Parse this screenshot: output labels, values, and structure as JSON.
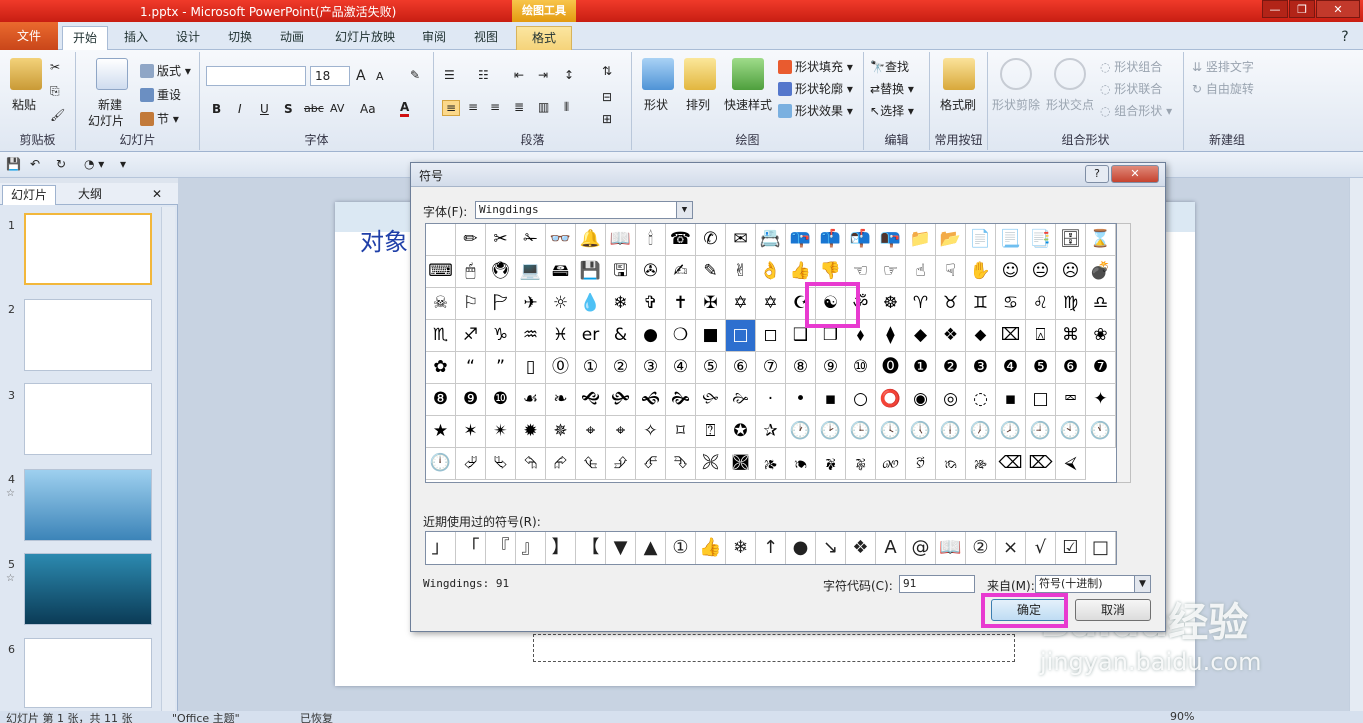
{
  "window": {
    "title": "1.pptx - Microsoft PowerPoint(产品激活失败)",
    "context_tab": "绘图工具",
    "buttons": [
      "—",
      "❐",
      "✕"
    ]
  },
  "tabs": {
    "file": "文件",
    "items": [
      "开始",
      "插入",
      "设计",
      "切换",
      "动画",
      "幻灯片放映",
      "审阅",
      "视图",
      "格式"
    ],
    "active": "开始"
  },
  "ribbon": {
    "clipboard": {
      "label": "剪贴板",
      "paste": "粘贴"
    },
    "slides": {
      "label": "幻灯片",
      "new_slide": "新建\n幻灯片",
      "new_slide_a": "新建",
      "new_slide_b": "幻灯片",
      "layout": "版式",
      "reset": "重设",
      "section": "节"
    },
    "font": {
      "label": "字体",
      "size": "18",
      "font_name": "",
      "bold": "B",
      "italic": "I",
      "underline": "U",
      "shadow": "S",
      "strike": "abc",
      "spacing": "AV",
      "case": "Aa",
      "color": "A",
      "grow": "A",
      "shrink": "A"
    },
    "paragraph": {
      "label": "段落"
    },
    "drawing": {
      "label": "绘图",
      "shapes": "形状",
      "arrange": "排列",
      "quick_styles": "快速样式",
      "fill": "形状填充",
      "outline": "形状轮廓",
      "effects": "形状效果"
    },
    "editing": {
      "label": "编辑",
      "find": "查找",
      "replace": "替换",
      "select": "选择"
    },
    "common": {
      "label": "常用按钮",
      "format_painter": "格式刷"
    },
    "combine": {
      "label": "组合形状",
      "cut": "形状剪除",
      "intersect": "形状交点",
      "combine": "形状组合",
      "union": "形状联合",
      "group": "组合形状"
    },
    "newgroup": {
      "label": "新建组",
      "vertical": "竖排文字",
      "rotate": "自由旋转"
    }
  },
  "left_pane": {
    "tabs": [
      "幻灯片",
      "大纲"
    ],
    "close": "✕",
    "slides": [
      "1",
      "2",
      "3",
      "4",
      "5",
      "6"
    ]
  },
  "slide": {
    "title": "对象"
  },
  "status": {
    "text": "幻灯片 第 1 张，共 11 张",
    "theme": "\"Office 主题\"",
    "lang": "已恢复",
    "zoom": "90%"
  },
  "dialog": {
    "title": "符号",
    "help": "?",
    "close": "✕",
    "font_label": "字体(F):",
    "font_value": "Wingdings",
    "recent_label": "近期使用过的符号(R):",
    "info": "Wingdings: 91",
    "code_label": "字符代码(C):",
    "code_value": "91",
    "from_label": "来自(M):",
    "from_value": "符号(十进制)",
    "ok": "确定",
    "cancel": "取消",
    "selected_index": 79,
    "symbols": [
      " ",
      "✏",
      "✂",
      "✁",
      "👓",
      "🔔",
      "📖",
      "🕯",
      "☎",
      "✆",
      "✉",
      "📇",
      "📪",
      "📫",
      "📬",
      "📭",
      "📁",
      "📂",
      "📄",
      "📃",
      "📑",
      "🗄",
      "⌛",
      "⌨",
      "🖱",
      "🖲",
      "💻",
      "🖴",
      "💾",
      "🖫",
      "✇",
      "✍",
      "✎",
      "✌",
      "👌",
      "👍",
      "👎",
      "☜",
      "☞",
      "☝",
      "☟",
      "✋",
      "☺",
      "😐",
      "☹",
      "💣",
      "☠",
      "⚐",
      "🏱",
      "✈",
      "☼",
      "💧",
      "❄",
      "✞",
      "✝",
      "✠",
      "✡",
      "✡",
      "☪",
      "☯",
      "ॐ",
      "☸",
      "♈",
      "♉",
      "♊",
      "♋",
      "♌",
      "♍",
      "♎",
      "♏",
      "♐",
      "♑",
      "♒",
      "♓",
      "er",
      "&",
      "●",
      "❍",
      "■",
      "□",
      "◻",
      "❑",
      "❒",
      "⬧",
      "⧫",
      "◆",
      "❖",
      "⬥",
      "⌧",
      "⍓",
      "⌘",
      "❀",
      "✿",
      "“",
      "”",
      "▯",
      "⓪",
      "①",
      "②",
      "③",
      "④",
      "⑤",
      "⑥",
      "⑦",
      "⑧",
      "⑨",
      "⑩",
      "⓿",
      "❶",
      "❷",
      "❸",
      "❹",
      "❺",
      "❻",
      "❼",
      "❽",
      "❾",
      "❿",
      "☙",
      "❧",
      "🙝",
      "🙟",
      "🙜",
      "🙞",
      "🙛",
      "🙚",
      "·",
      "•",
      "▪",
      "○",
      "⭕",
      "◉",
      "◎",
      "◌",
      "▪",
      "□",
      "⮹",
      "✦",
      "★",
      "✶",
      "✴",
      "✹",
      "✵",
      "⌖",
      "⌖",
      "✧",
      "⌑",
      "⍰",
      "✪",
      "✰",
      "🕐",
      "🕑",
      "🕒",
      "🕓",
      "🕔",
      "🕕",
      "🕖",
      "🕗",
      "🕘",
      "🕙",
      "🕚",
      "🕛",
      "⮰",
      "⮱",
      "⮲",
      "⮳",
      "⮴",
      "⮵",
      "⮶",
      "⮷",
      "🙪",
      "🙫",
      "🙕",
      "🙔",
      "🙗",
      "🙖",
      "🙐",
      "🙑",
      "🙒",
      "🙓",
      "⌫",
      "⌦",
      "⮘"
    ],
    "recent": [
      "」",
      "「",
      "『",
      "』",
      "】",
      "【",
      "▼",
      "▲",
      "①",
      "👍",
      "❄",
      "↑",
      "●",
      "↘",
      "❖",
      "A",
      "@",
      "📖",
      "②",
      "×",
      "√",
      "☑",
      "□"
    ]
  },
  "watermark": {
    "logo": "Baidu经验",
    "url": "jingyan.baidu.com"
  }
}
